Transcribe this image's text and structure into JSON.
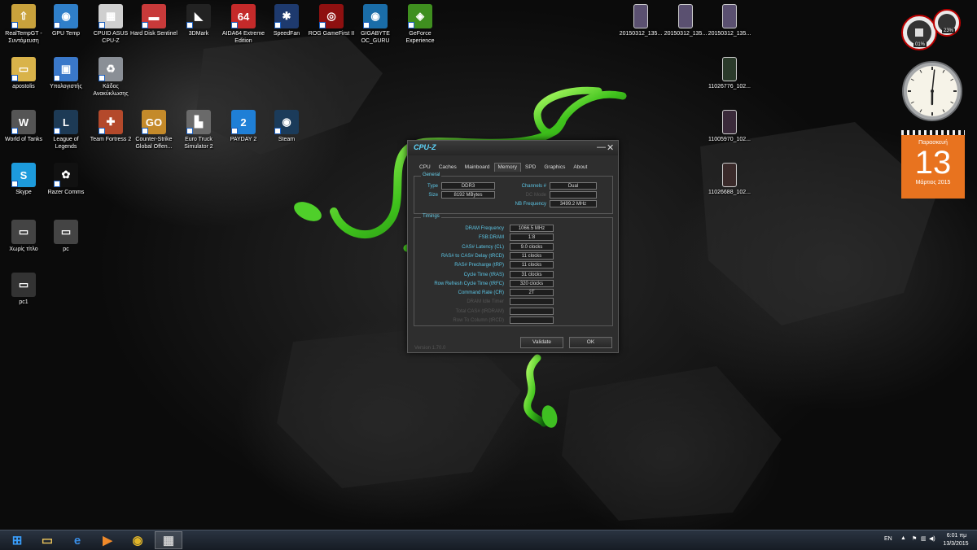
{
  "desktop": {
    "icons": [
      {
        "label": "RealTempGT - Συντόμευση",
        "icon": "realtemp-icon",
        "color": "#c9a23c",
        "glyph": "⇧"
      },
      {
        "label": "GPU Temp",
        "icon": "gpu-temp-icon",
        "color": "#2f7fc9",
        "glyph": "◉"
      },
      {
        "label": "CPUID ASUS CPU-Z",
        "icon": "cpuz-icon",
        "color": "#cfcfcf",
        "glyph": "▦"
      },
      {
        "label": "Hard Disk Sentinel",
        "icon": "hard-disk-sentinel-icon",
        "color": "#c83a3a",
        "glyph": "▬"
      },
      {
        "label": "3DMark",
        "icon": "3dmark-icon",
        "color": "#222222",
        "glyph": "◣"
      },
      {
        "label": "AIDA64 Extreme Edition",
        "icon": "aida64-icon",
        "color": "#c42a2a",
        "glyph": "64"
      },
      {
        "label": "SpeedFan",
        "icon": "speedfan-icon",
        "color": "#1e3a6e",
        "glyph": "✱"
      },
      {
        "label": "ROG GameFirst II",
        "icon": "rog-gamefirst-icon",
        "color": "#8e1010",
        "glyph": "◎"
      },
      {
        "label": "GIGABYTE OC_GURU",
        "icon": "gigabyte-oc-guru-icon",
        "color": "#1a6da8",
        "glyph": "◉"
      },
      {
        "label": "GeForce Experience",
        "icon": "geforce-experience-icon",
        "color": "#3f8f1f",
        "glyph": "◈"
      },
      {
        "label": "apostolis",
        "icon": "user-folder-icon",
        "color": "#d9b34a",
        "glyph": "▭"
      },
      {
        "label": "Υπολογιστής",
        "icon": "computer-icon",
        "color": "#3a78c9",
        "glyph": "▣"
      },
      {
        "label": "Κάδος Ανακύκλωσης",
        "icon": "recycle-bin-icon",
        "color": "#8a8f96",
        "glyph": "♻"
      },
      {
        "label": "World of Tanks",
        "icon": "world-of-tanks-icon",
        "color": "#555555",
        "glyph": "W"
      },
      {
        "label": "League of Legends",
        "icon": "league-of-legends-icon",
        "color": "#1d3a55",
        "glyph": "L"
      },
      {
        "label": "Team Fortress 2",
        "icon": "team-fortress-2-icon",
        "color": "#b4492b",
        "glyph": "✚"
      },
      {
        "label": "Counter-Strike Global Offen...",
        "icon": "counter-strike-icon",
        "color": "#c48a2a",
        "glyph": "GO"
      },
      {
        "label": "Euro Truck Simulator 2",
        "icon": "euro-truck-simulator-icon",
        "color": "#6a6a6a",
        "glyph": "▙"
      },
      {
        "label": "PAYDAY 2",
        "icon": "payday-2-icon",
        "color": "#1f7fd6",
        "glyph": "2"
      },
      {
        "label": "Steam",
        "icon": "steam-icon",
        "color": "#1b3b5a",
        "glyph": "◉"
      },
      {
        "label": "Skype",
        "icon": "skype-icon",
        "color": "#1d9bdc",
        "glyph": "S"
      },
      {
        "label": "Razer Comms",
        "icon": "razer-comms-icon",
        "color": "#111111",
        "glyph": "✿"
      },
      {
        "label": "Χωρίς τίτλο",
        "icon": "image-file-icon",
        "color": "#444444",
        "glyph": "▭"
      },
      {
        "label": "pc",
        "icon": "image-file-icon",
        "color": "#444444",
        "glyph": "▭"
      },
      {
        "label": "pc1",
        "icon": "image-file-icon",
        "color": "#333333",
        "glyph": "▭"
      },
      {
        "label": "20150312_135...",
        "icon": "photo-file-icon",
        "color": "#5a5070",
        "glyph": ""
      },
      {
        "label": "20150312_135...",
        "icon": "photo-file-icon",
        "color": "#5a5070",
        "glyph": ""
      },
      {
        "label": "20150312_135...",
        "icon": "photo-file-icon",
        "color": "#5a5070",
        "glyph": ""
      },
      {
        "label": "11026776_102...",
        "icon": "photo-file-icon",
        "color": "#2a3a2a",
        "glyph": ""
      },
      {
        "label": "11005970_102...",
        "icon": "photo-file-icon",
        "color": "#3a2a3a",
        "glyph": ""
      },
      {
        "label": "11026688_102...",
        "icon": "photo-file-icon",
        "color": "#3a2a2a",
        "glyph": ""
      }
    ]
  },
  "gadgets": {
    "cpu_meter": {
      "cpu_percent": "01%",
      "memory_percent": "23%"
    },
    "clock": {
      "hour": 6,
      "minute": 1
    },
    "calendar": {
      "weekday": "Παρασκευή",
      "day": "13",
      "month_year": "Μάρτιος 2015",
      "color": "#e8731f"
    }
  },
  "cpuz": {
    "title": "CPU-Z",
    "tabs": [
      "CPU",
      "Caches",
      "Mainboard",
      "Memory",
      "SPD",
      "Graphics",
      "About"
    ],
    "active_tab": "Memory",
    "general": {
      "group_title": "General",
      "type_label": "Type",
      "type_value": "DDR3",
      "size_label": "Size",
      "size_value": "8192 MBytes",
      "channels_label": "Channels #",
      "channels_value": "Dual",
      "dc_mode_label": "DC Mode",
      "dc_mode_value": "",
      "nb_freq_label": "NB Frequency",
      "nb_freq_value": "3499.2 MHz"
    },
    "timings": {
      "group_title": "Timings",
      "rows": [
        {
          "label": "DRAM Frequency",
          "value": "1066.5 MHz",
          "enabled": true
        },
        {
          "label": "FSB:DRAM",
          "value": "1:8",
          "enabled": true
        },
        {
          "label": "CAS# Latency (CL)",
          "value": "9.0 clocks",
          "enabled": true
        },
        {
          "label": "RAS# to CAS# Delay (tRCD)",
          "value": "11 clocks",
          "enabled": true
        },
        {
          "label": "RAS# Precharge (tRP)",
          "value": "11 clocks",
          "enabled": true
        },
        {
          "label": "Cycle Time (tRAS)",
          "value": "31 clocks",
          "enabled": true
        },
        {
          "label": "Row Refresh Cycle Time (tRFC)",
          "value": "320 clocks",
          "enabled": true
        },
        {
          "label": "Command Rate (CR)",
          "value": "2T",
          "enabled": true
        },
        {
          "label": "DRAM Idle Timer",
          "value": "",
          "enabled": false
        },
        {
          "label": "Total CAS# (tRDRAM)",
          "value": "",
          "enabled": false
        },
        {
          "label": "Row To Column (tRCD)",
          "value": "",
          "enabled": false
        }
      ]
    },
    "version": "Version 1.70.0",
    "validate_label": "Validate",
    "ok_label": "OK"
  },
  "taskbar": {
    "items": [
      {
        "name": "start-button",
        "glyph": "⊞",
        "color": "#3aa0ff"
      },
      {
        "name": "file-explorer-button",
        "glyph": "▭",
        "color": "#e7c15a"
      },
      {
        "name": "internet-explorer-button",
        "glyph": "e",
        "color": "#3a8fe8"
      },
      {
        "name": "media-player-button",
        "glyph": "▶",
        "color": "#f08a2a"
      },
      {
        "name": "chrome-button",
        "glyph": "◉",
        "color": "#e0b52a"
      },
      {
        "name": "cpuz-taskbar-button",
        "glyph": "▦",
        "color": "#cfcfcf"
      }
    ],
    "language": "EN",
    "time": "6:01 πμ",
    "date": "13/3/2015"
  }
}
